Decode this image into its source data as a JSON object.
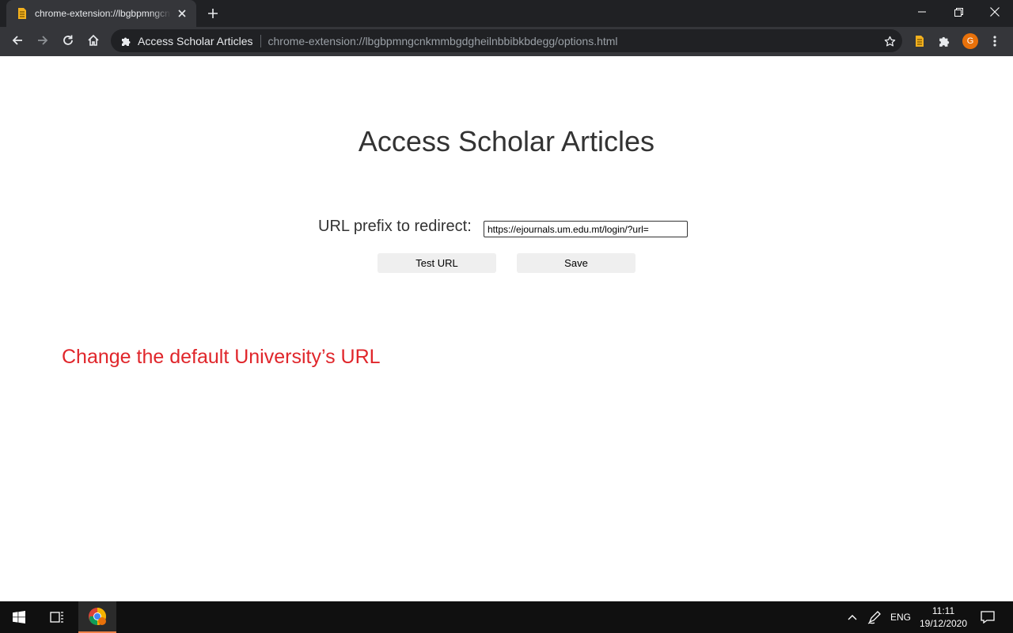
{
  "browser": {
    "tab": {
      "title": "chrome-extension://lbgbpmngcnkmmbgdgheilnbbibkbdegg/options.html",
      "favicon": "extension-page-icon"
    },
    "omnibox": {
      "chip_label": "Access Scholar Articles",
      "url": "chrome-extension://lbgbpmngcnkmmbgdgheilnbbibkbdegg/options.html"
    },
    "profile_initial": "G",
    "colors": {
      "frame": "#202124",
      "toolbar": "#35363a",
      "avatar": "#e8710a"
    }
  },
  "page": {
    "title": "Access Scholar Articles",
    "url_prefix": {
      "label": "URL prefix to redirect:",
      "value": "https://ejournals.um.edu.mt/login/?url="
    },
    "buttons": {
      "test_url": "Test URL",
      "save": "Save"
    },
    "annotation": {
      "text": "Change the default University’s URL",
      "color": "#e0262b"
    }
  },
  "taskbar": {
    "language": "ENG",
    "time": "11:11",
    "date": "19/12/2020"
  }
}
